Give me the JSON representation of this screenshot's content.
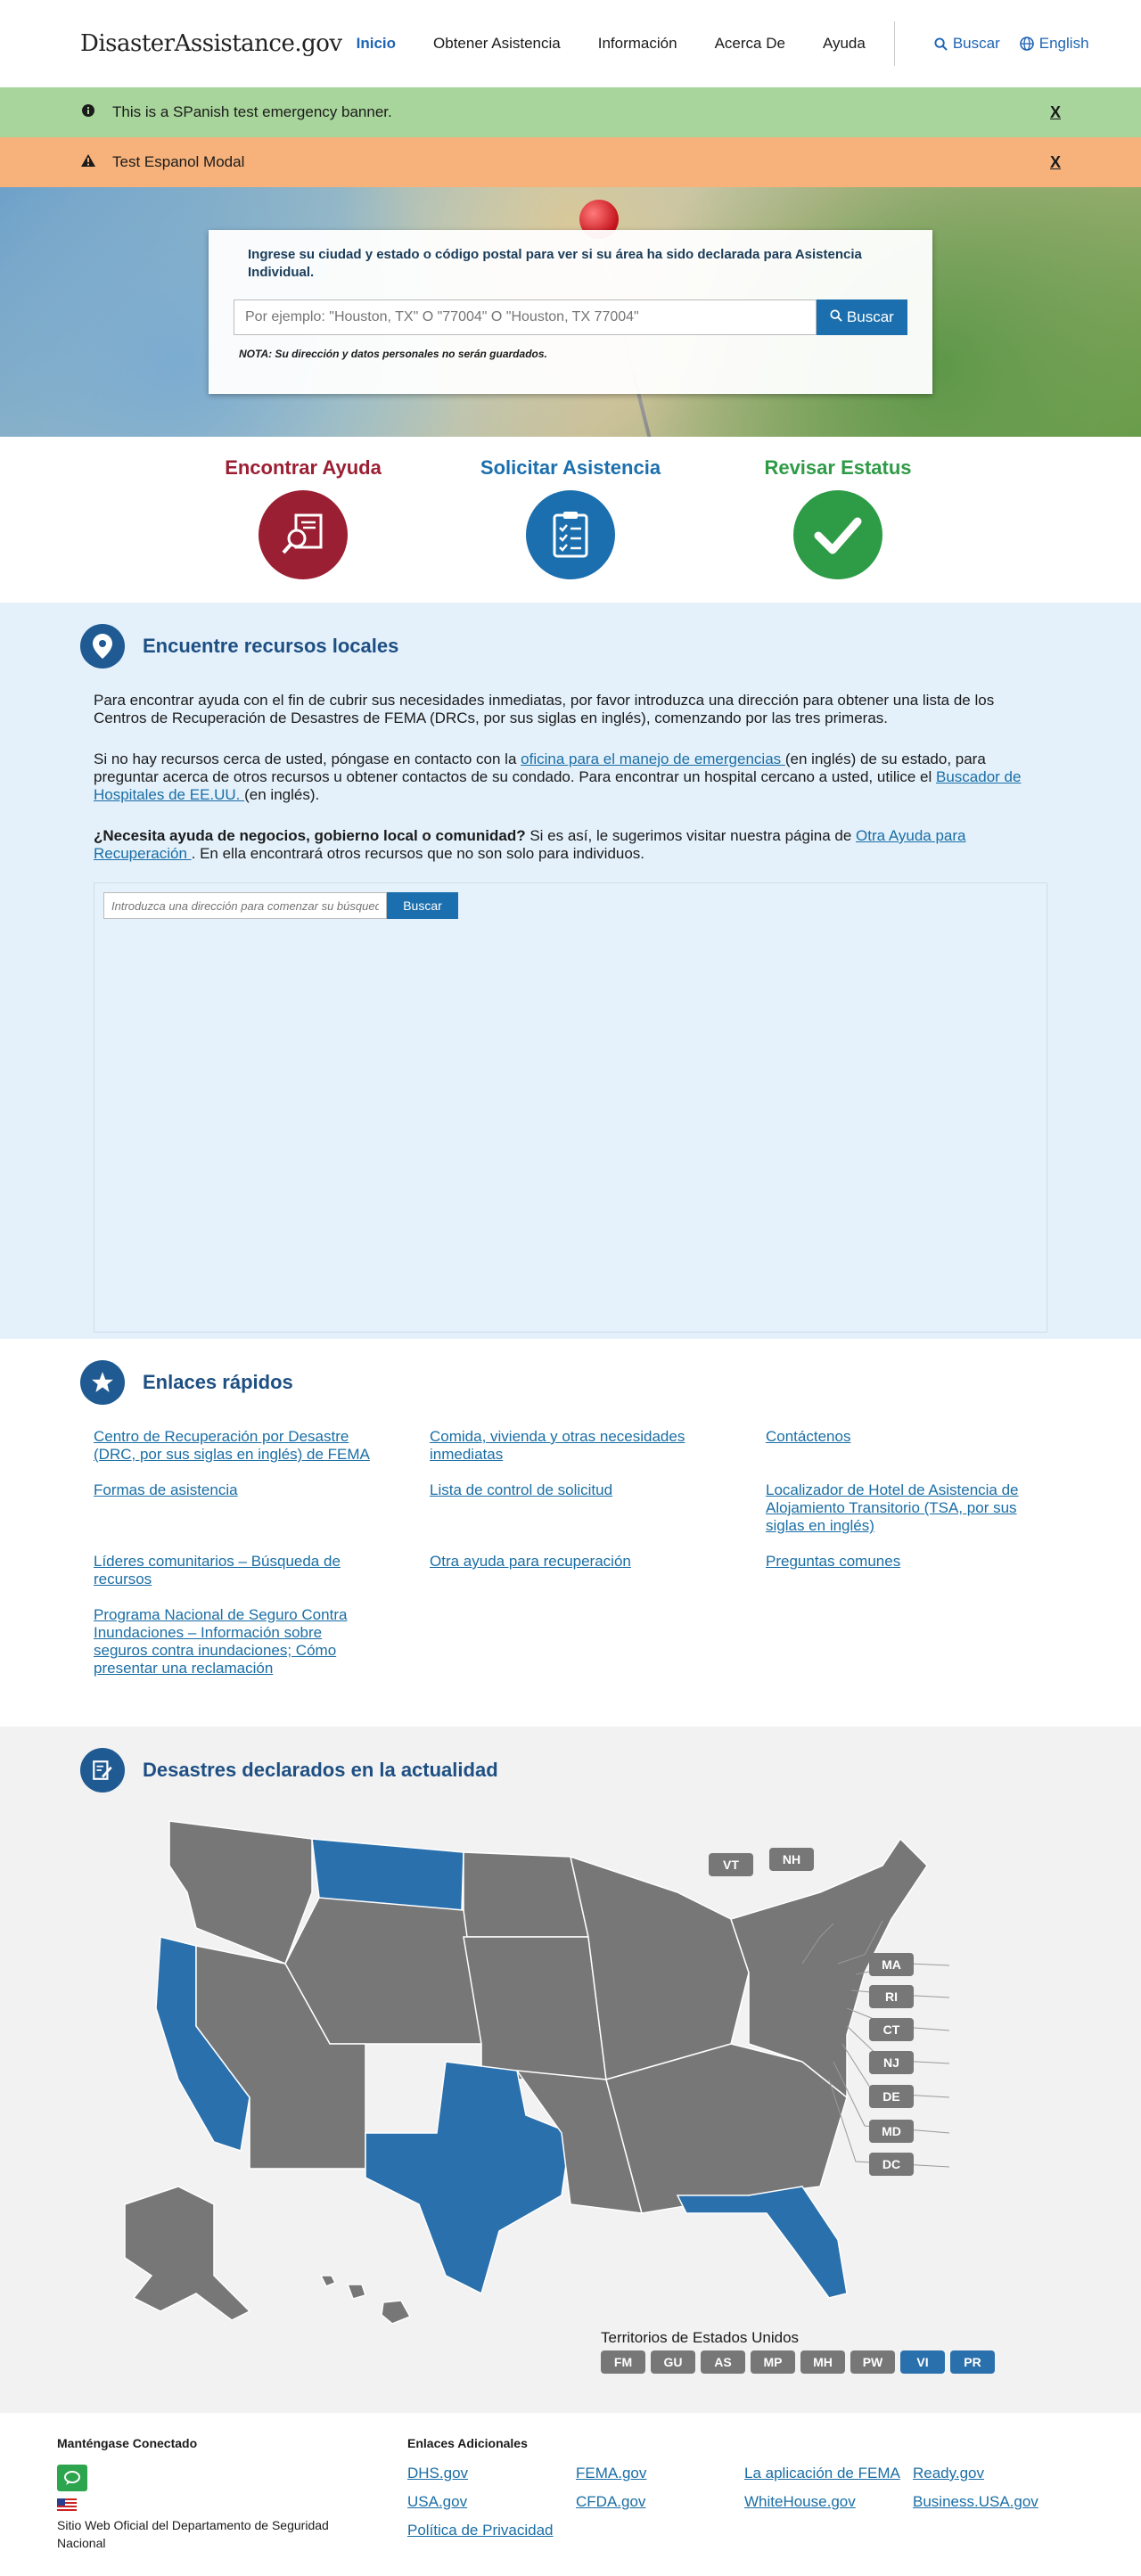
{
  "header": {
    "logo_prefix": "DisasterAssistance",
    "logo_suffix": ".gov",
    "nav": [
      "Inicio",
      "Obtener Asistencia",
      "Información",
      "Acerca De",
      "Ayuda"
    ],
    "search_label": "Buscar",
    "language_label": "English"
  },
  "banners": {
    "emergency_text": "This is a SPanish test emergency banner.",
    "modal_text": "Test Espanol Modal",
    "close_label": "X"
  },
  "hero": {
    "prompt": "Ingrese su ciudad y estado o código postal para ver si su área ha sido declarada para Asistencia Individual.",
    "placeholder": "Por ejemplo: \"Houston, TX\" O \"77004\" O \"Houston, TX 77004\"",
    "search_button": "Buscar",
    "note": "NOTA: Su dirección y datos personales no serán guardados."
  },
  "actions": [
    {
      "label": "Encontrar Ayuda",
      "color": "#9b1f32"
    },
    {
      "label": "Solicitar Asistencia",
      "color": "#1b6fae"
    },
    {
      "label": "Revisar Estatus",
      "color": "#2e9b46"
    }
  ],
  "local": {
    "title": "Encuentre recursos locales",
    "p1": "Para encontrar ayuda con el fin de cubrir sus necesidades inmediatas, por favor introduzca una dirección para obtener una lista de los Centros de Recuperación de Desastres de FEMA (DRCs, por sus siglas en inglés), comenzando por las tres primeras.",
    "p2_a": "Si no hay recursos cerca de usted, póngase en contacto con la ",
    "p2_link1": "oficina para el manejo de emergencias ",
    "p2_b": "(en inglés) de su estado, para preguntar acerca de otros recursos u obtener contactos de su condado. Para encontrar un hospital cercano a usted, utilice el ",
    "p2_link2": "Buscador de Hospitales de EE.UU. ",
    "p2_c": "(en inglés).",
    "p3_bold": "¿Necesita ayuda de negocios, gobierno local o comunidad?",
    "p3_a": " Si es así, le sugerimos visitar nuestra página de ",
    "p3_link": "Otra Ayuda para Recuperación ",
    "p3_b": ". En ella encontrará otros recursos que no son solo para individuos.",
    "map_placeholder": "Introduzca una dirección para comenzar su búsqueda",
    "map_button": "Buscar"
  },
  "quick_links": {
    "title": "Enlaces rápidos",
    "items": [
      "Centro de Recuperación por Desastre (DRC, por sus siglas en inglés) de FEMA",
      "Comida, vivienda y otras necesidades inmediatas",
      "Contáctenos",
      "Formas de asistencia",
      "Lista de control de solicitud",
      "Localizador de Hotel de Asistencia de Alojamiento Transitorio (TSA, por sus siglas en inglés)",
      "Líderes comunitarios – Búsqueda de recursos",
      "Otra ayuda para recuperación",
      "Preguntas comunes",
      "Programa Nacional de Seguro Contra Inundaciones – Información sobre seguros contra inundaciones; Cómo presentar una reclamación"
    ]
  },
  "declared": {
    "title": "Desastres declarados en la actualidad",
    "highlighted_states": [
      "Montana",
      "California",
      "Texas",
      "Florida"
    ],
    "small_states": [
      "VT",
      "NH",
      "MA",
      "RI",
      "CT",
      "NJ",
      "DE",
      "MD",
      "DC"
    ],
    "territories_title": "Territorios de Estados Unidos",
    "territories": [
      "FM",
      "GU",
      "AS",
      "MP",
      "MH",
      "PW",
      "VI",
      "PR"
    ],
    "highlighted_territories": [
      "VI",
      "PR"
    ],
    "declared_color": "#2a70ad",
    "default_color": "#777777"
  },
  "footer": {
    "connected_title": "Manténgase Conectado",
    "official_site": "Sitio Web Oficial del Departamento de Seguridad Nacional",
    "links_title": "Enlaces Adicionales",
    "links": [
      "DHS.gov",
      "FEMA.gov",
      "La aplicación de FEMA",
      "Ready.gov",
      "USA.gov",
      "CFDA.gov",
      "WhiteHouse.gov",
      "Business.USA.gov",
      "Política de Privacidad"
    ]
  }
}
